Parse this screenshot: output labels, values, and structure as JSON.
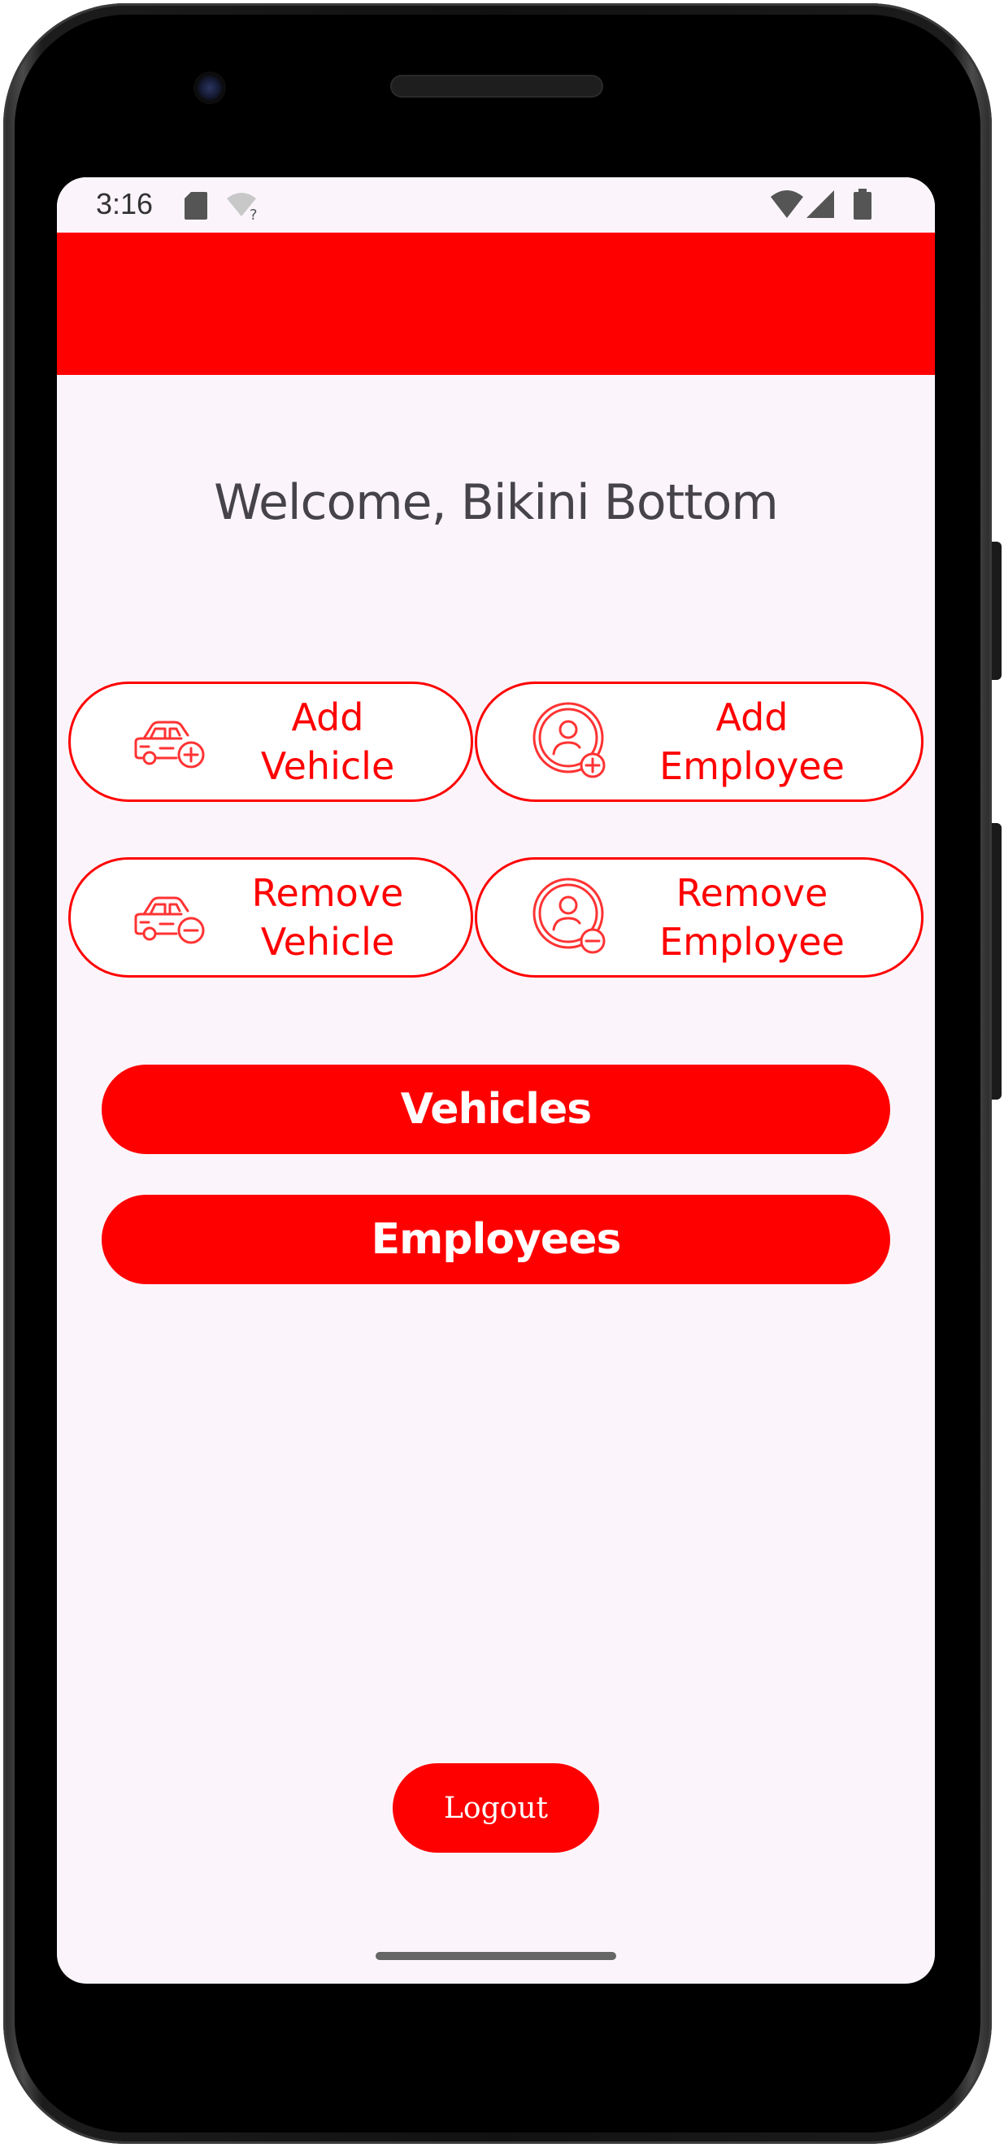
{
  "status_bar": {
    "time": "3:16",
    "icons": [
      "sd-card-icon",
      "wifi-question-icon",
      "wifi-icon",
      "cell-signal-icon",
      "battery-icon"
    ]
  },
  "app_bar": {
    "color": "#ff0000"
  },
  "welcome": {
    "text": "Welcome, Bikini Bottom"
  },
  "actions": {
    "add_vehicle": {
      "label": "Add\nVehicle",
      "icon": "car-add-icon"
    },
    "add_employee": {
      "label": "Add\nEmployee",
      "icon": "user-add-icon"
    },
    "remove_vehicle": {
      "label": "Remove\nVehicle",
      "icon": "car-remove-icon"
    },
    "remove_employee": {
      "label": "Remove\nEmployee",
      "icon": "user-remove-icon"
    }
  },
  "buttons": {
    "vehicles": "Vehicles",
    "employees": "Employees",
    "logout": "Logout"
  },
  "colors": {
    "accent": "#ff0000",
    "background": "#fbf5fb",
    "text": "#46434a"
  }
}
